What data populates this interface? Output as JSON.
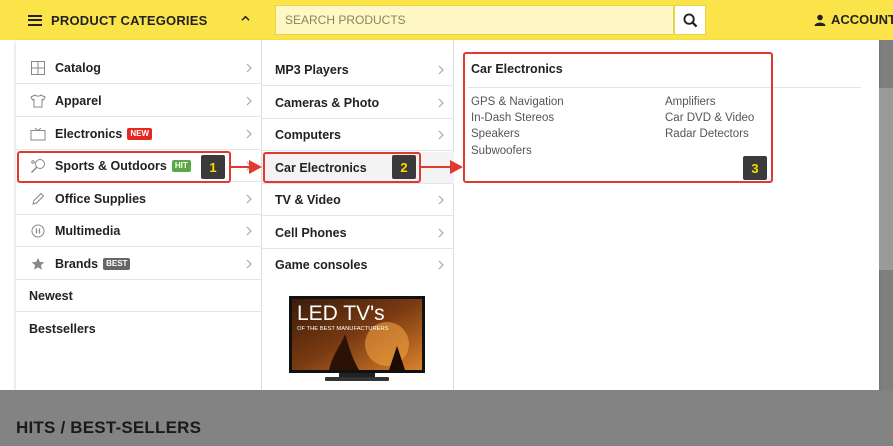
{
  "header": {
    "categories_label": "PRODUCT CATEGORIES",
    "search_placeholder": "SEARCH PRODUCTS",
    "account_label": "ACCOUNT"
  },
  "categories": [
    {
      "label": "Catalog",
      "icon": "grid-icon",
      "badge": null
    },
    {
      "label": "Apparel",
      "icon": "shirt-icon",
      "badge": null
    },
    {
      "label": "Electronics",
      "icon": "tv-icon",
      "badge": "NEW",
      "badge_color": "#e5271f"
    },
    {
      "label": "Sports & Outdoors",
      "icon": "tennis-racket-icon",
      "badge": "HIT",
      "badge_color": "#5aa845"
    },
    {
      "label": "Office Supplies",
      "icon": "pencil-icon",
      "badge": null
    },
    {
      "label": "Multimedia",
      "icon": "pause-circle-icon",
      "badge": null
    },
    {
      "label": "Brands",
      "icon": "star-icon",
      "badge": "BEST",
      "badge_color": "#666666"
    },
    {
      "label": "Newest",
      "icon": null,
      "badge": null
    },
    {
      "label": "Bestsellers",
      "icon": null,
      "badge": null
    }
  ],
  "subcategories": [
    {
      "label": "MP3 Players"
    },
    {
      "label": "Cameras & Photo"
    },
    {
      "label": "Computers"
    },
    {
      "label": "Car Electronics",
      "active": true
    },
    {
      "label": "TV & Video"
    },
    {
      "label": "Cell Phones"
    },
    {
      "label": "Game consoles"
    }
  ],
  "promo": {
    "headline": "LED TV's",
    "subline": "OF THE BEST MANUFACTURERS"
  },
  "panel": {
    "title": "Car Electronics",
    "left_links": [
      "GPS & Navigation",
      "In-Dash Stereos",
      "Speakers",
      "Subwoofers"
    ],
    "right_links": [
      "Amplifiers",
      "Car DVD & Video",
      "Radar Detectors"
    ]
  },
  "callouts": [
    "1",
    "2",
    "3"
  ],
  "section_heading": "HITS / BEST-SELLERS",
  "colors": {
    "brand_yellow": "#fbe44a",
    "callout_red": "#e03a2f",
    "tag_bg": "#3a3a3a",
    "tag_text": "#ffd800"
  }
}
